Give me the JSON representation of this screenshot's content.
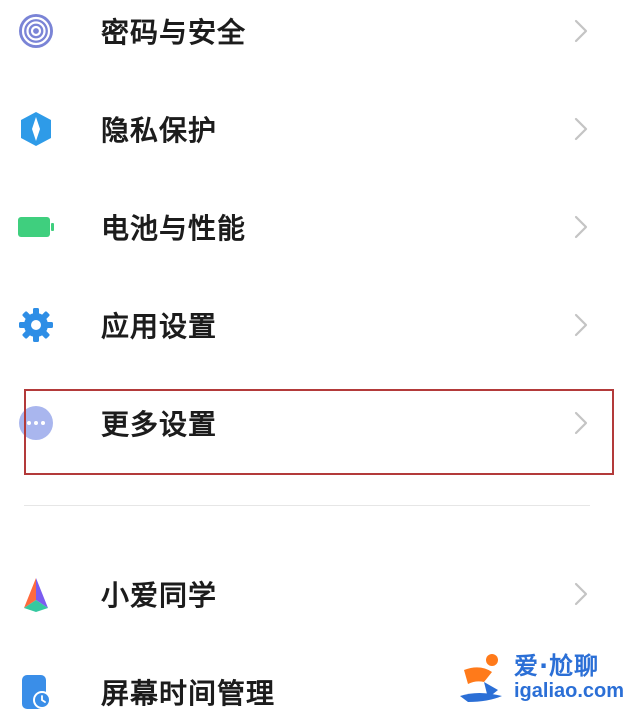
{
  "settings": {
    "items": [
      {
        "label": "密码与安全",
        "icon": "fingerprint-icon"
      },
      {
        "label": "隐私保护",
        "icon": "privacy-shield-icon"
      },
      {
        "label": "电池与性能",
        "icon": "battery-icon"
      },
      {
        "label": "应用设置",
        "icon": "gear-icon"
      },
      {
        "label": "更多设置",
        "icon": "more-dots-icon"
      },
      {
        "label": "小爱同学",
        "icon": "xiaoai-icon"
      },
      {
        "label": "屏幕时间管理",
        "icon": "screen-time-icon"
      }
    ]
  },
  "watermark": {
    "title": "爱·尬聊",
    "url": "igaliao.com"
  },
  "colors": {
    "highlight": "#b33a3a",
    "watermark": "#2b6fd6"
  }
}
